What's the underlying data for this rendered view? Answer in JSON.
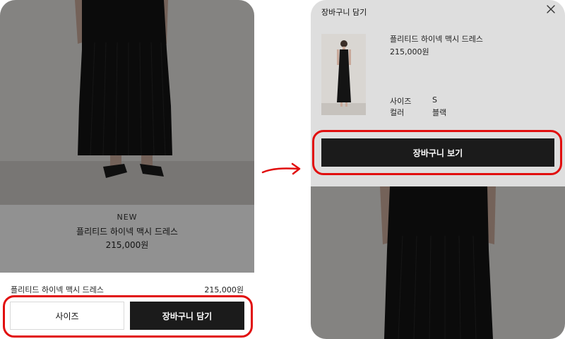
{
  "colors": {
    "highlight": "#e10e0e",
    "primary_button": "#1b1b1b",
    "dress": "#121212"
  },
  "left_screen": {
    "product": {
      "badge": "NEW",
      "name": "플리티드 하이넥 맥시 드레스",
      "price": "215,000원"
    },
    "bottom_bar": {
      "name": "플리티드 하이넥 맥시 드레스",
      "price": "215,000원",
      "size_button": "사이즈",
      "add_to_cart_button": "장바구니 담기"
    }
  },
  "arrow_icon": "arrow-right-icon",
  "right_screen": {
    "sheet": {
      "title": "장바구니 담기",
      "close_icon": "close-icon",
      "item": {
        "name": "플리티드 하이넥 맥시 드레스",
        "price": "215,000원",
        "options": [
          {
            "label": "사이즈",
            "value": "S"
          },
          {
            "label": "컬러",
            "value": "블랙"
          }
        ]
      },
      "view_cart_button": "장바구니 보기"
    }
  }
}
